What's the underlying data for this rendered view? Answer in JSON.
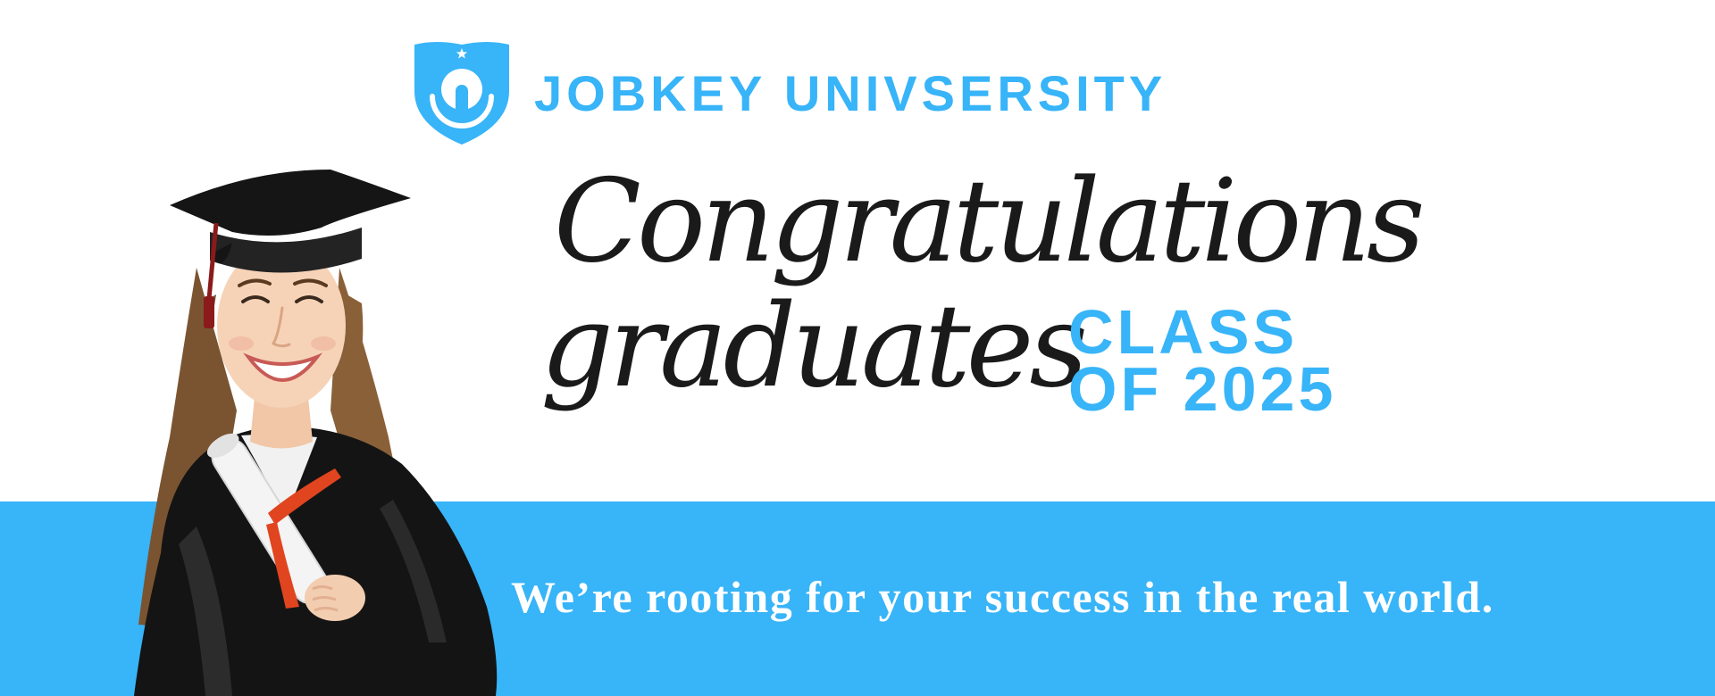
{
  "brand": {
    "name": "JOBKEY UNIVSERSITY",
    "logo_icon": "shield-key-icon"
  },
  "headline": {
    "line1": "Congratulations",
    "line2": "graduates"
  },
  "class_of": {
    "line1": "CLASS",
    "line2": "OF 2025"
  },
  "tagline": "We’re rooting for your success in the real world.",
  "graduate_photo": {
    "icon": "graduate-photo"
  },
  "colors": {
    "accent": "#38b4f8",
    "headline": "#1a1a1a",
    "background": "#ffffff",
    "tagline": "#ffffff",
    "tassel": "#8b1a1a",
    "ribbon": "#e0451f"
  }
}
